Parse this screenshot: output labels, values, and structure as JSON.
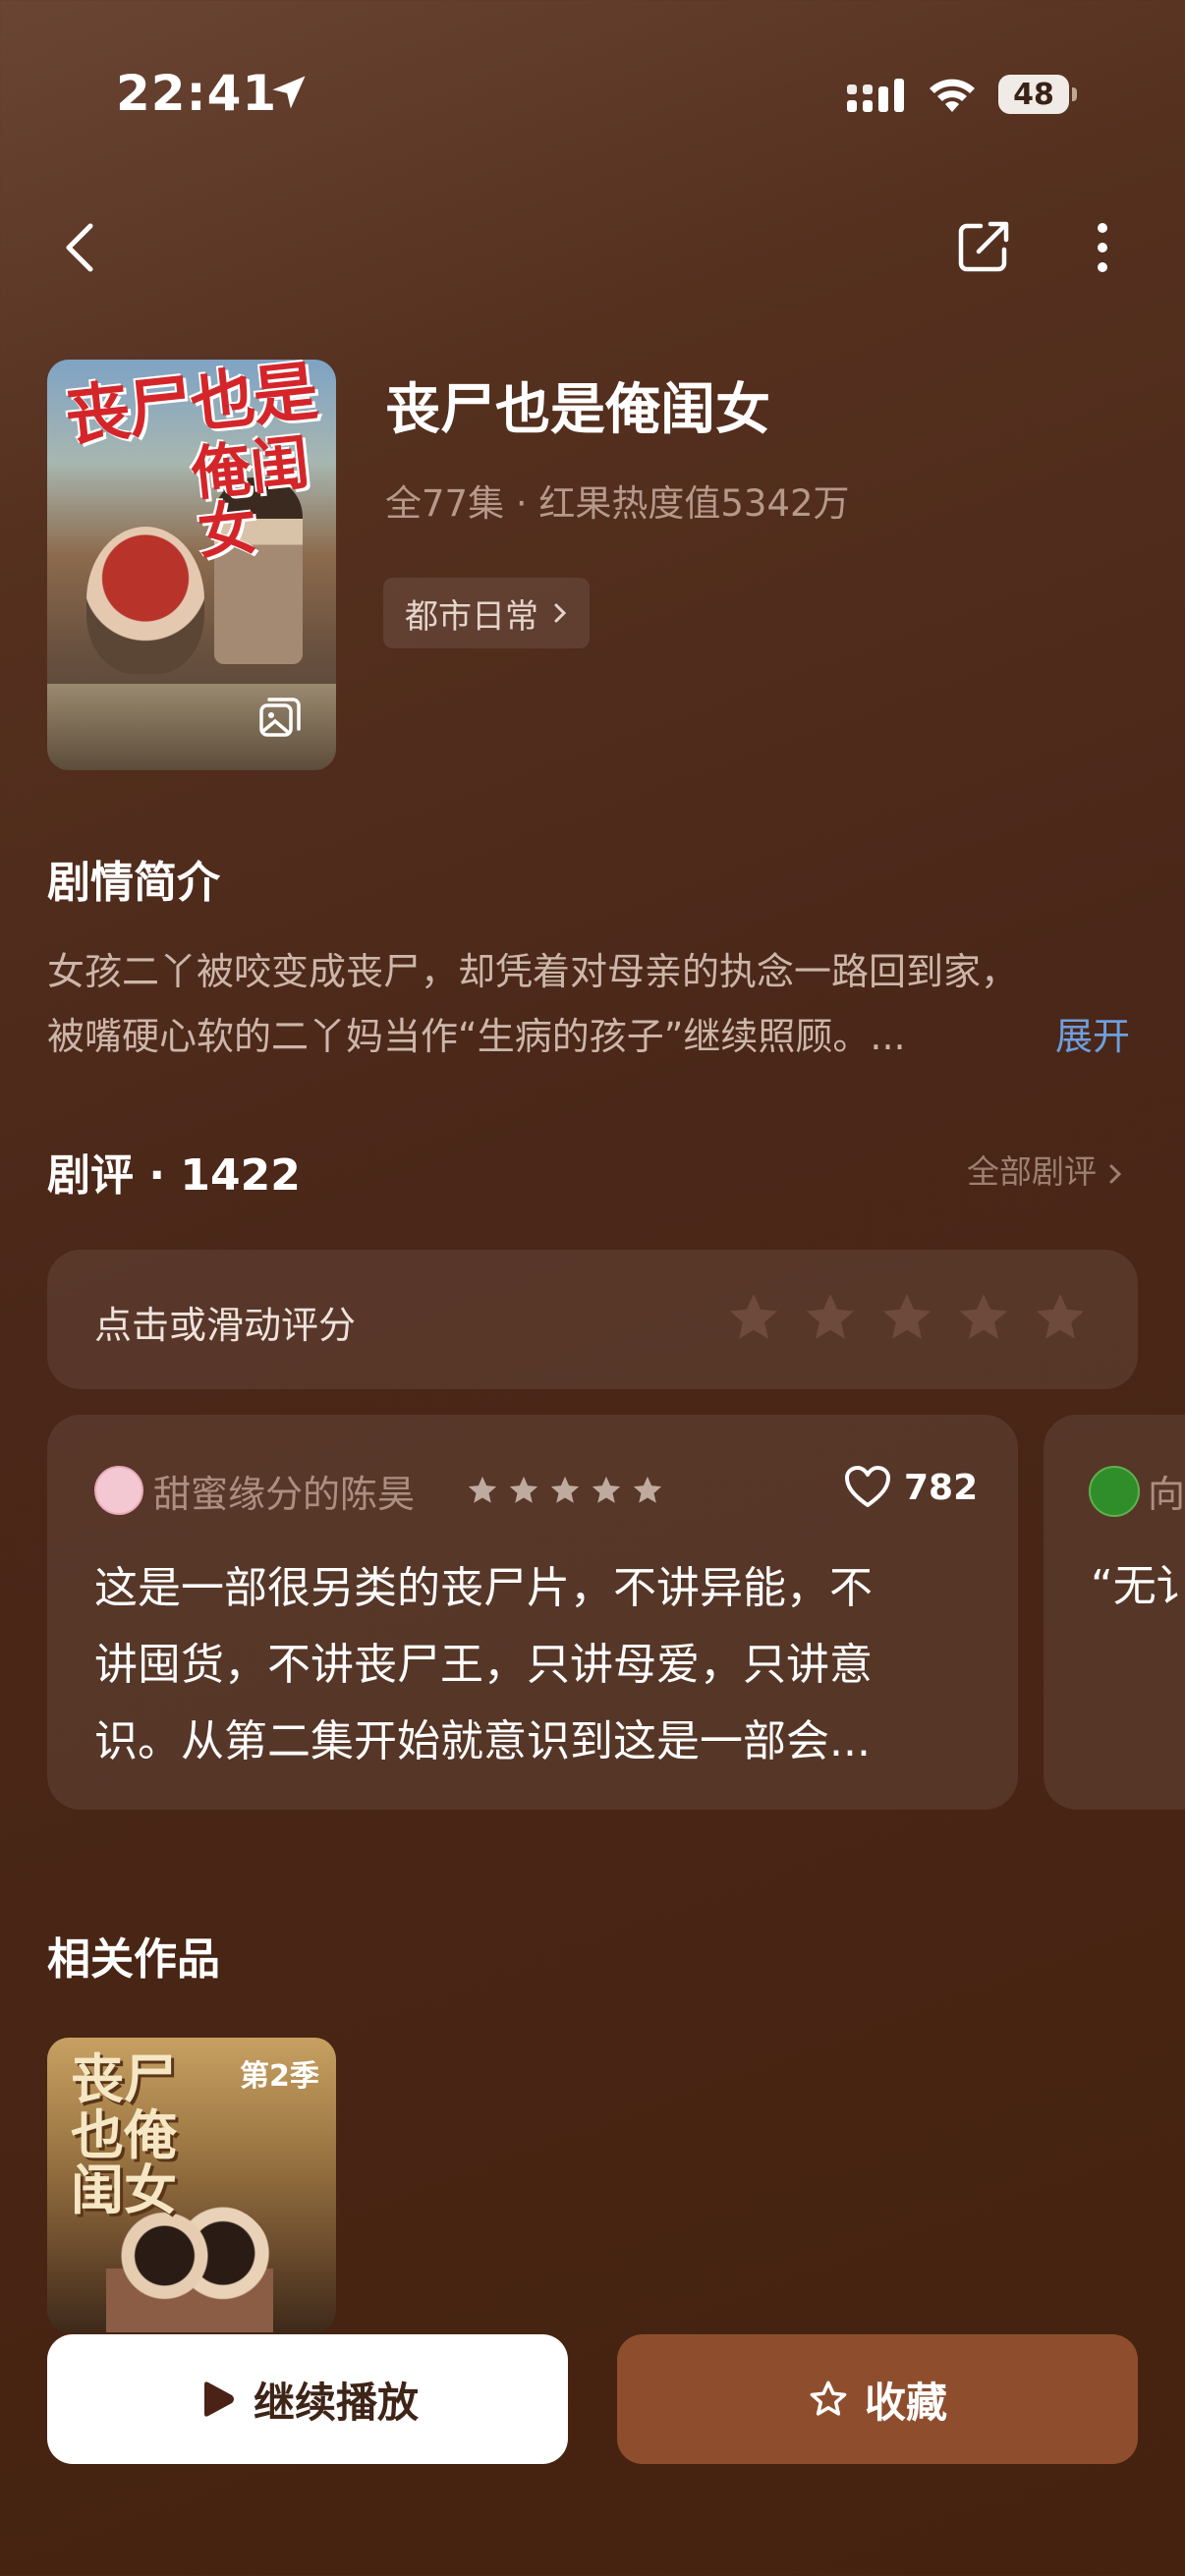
{
  "status_bar": {
    "time": "22:41",
    "battery": "48"
  },
  "show": {
    "title": "丧尸也是俺闺女",
    "meta": "全77集 · 红果热度值5342万",
    "genre": "都市日常",
    "poster_text_line1": "丧尸也是",
    "poster_text_line2": "俺闺女"
  },
  "synopsis": {
    "heading": "剧情简介",
    "line1": "女孩二丫被咬变成丧尸，却凭着对母亲的执念一路回到家，",
    "line2": "被嘴硬心软的二丫妈当作“生病的孩子”继续照顾。...",
    "expand": "展开"
  },
  "reviews": {
    "heading": "剧评 · 1422",
    "all_link": "全部剧评",
    "rate_prompt": "点击或滑动评分",
    "cards": [
      {
        "user": "甜蜜缘分的陈昊",
        "rating": 5,
        "likes": "782",
        "lines": [
          "这是一部很另类的丧尸片，不讲异能，不",
          "讲囤货，不讲丧尸王，只讲母爱，只讲意",
          "识。从第二集开始就意识到这是一部会..."
        ]
      },
      {
        "user": "向",
        "quote": "“无讠"
      }
    ]
  },
  "related": {
    "heading": "相关作品",
    "items": [
      {
        "poster_title": "丧尸也俺闺女",
        "season": "第2季"
      }
    ]
  },
  "actions": {
    "play": "继续播放",
    "favorite": "收藏"
  },
  "colors": {
    "accent_button": "#8e4e2e",
    "expand_link": "#6e9fe0"
  }
}
